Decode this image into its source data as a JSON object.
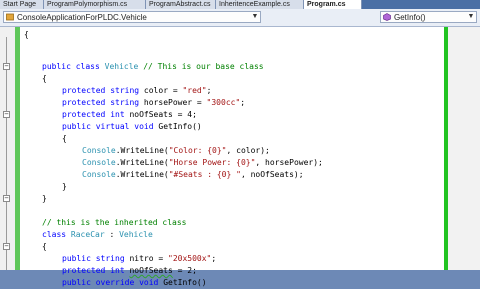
{
  "tabs": [
    {
      "label": "Start Page",
      "active": false
    },
    {
      "label": "ProgramPolymorphism.cs",
      "active": false
    },
    {
      "label": "ProgramAbstract.cs",
      "active": false
    },
    {
      "label": "InheritenceExample.cs",
      "active": false
    },
    {
      "label": "Program.cs",
      "active": true
    }
  ],
  "navbar": {
    "class_combo": "ConsoleApplicationForPLDC.Vehicle",
    "member_combo": "GetInfo()"
  },
  "colors": {
    "keyword": "#0000ff",
    "type": "#2b91af",
    "string": "#a31515",
    "comment": "#008000",
    "change_bar": "#5fc75a",
    "highlight_border": "#22c322"
  },
  "code": {
    "l1": "{",
    "l2_kw1": "public",
    "l2_kw2": "class",
    "l2_type": "Vehicle",
    "l2_comment": "// This is our base class",
    "l3": "{",
    "l4_kw1": "protected",
    "l4_kw2": "string",
    "l4_plain": "color =",
    "l4_str": "\"red\"",
    "l4_end": ";",
    "l5_kw1": "protected",
    "l5_kw2": "string",
    "l5_plain": "horsePower =",
    "l5_str": "\"300cc\"",
    "l5_end": ";",
    "l6_kw1": "protected",
    "l6_kw2": "int",
    "l6_plain": "noOfSeats = 4;",
    "l7_kw1": "public",
    "l7_kw2": "virtual",
    "l7_kw3": "void",
    "l7_plain": "GetInfo()",
    "l8": "{",
    "l9_type": "Console",
    "l9_plain1": ".WriteLine(",
    "l9_str": "\"Color: {0}\"",
    "l9_plain2": ", color);",
    "l10_type": "Console",
    "l10_plain1": ".WriteLine(",
    "l10_str": "\"Horse Power: {0}\"",
    "l10_plain2": ", horsePower);",
    "l11_type": "Console",
    "l11_plain1": ".WriteLine(",
    "l11_str": "\"#Seats : {0} \"",
    "l11_plain2": ", noOfSeats);",
    "l12": "}",
    "l13": "}",
    "l14_comment": "// this is the inherited class",
    "l15_kw": "class",
    "l15_type1": "RaceCar",
    "l15_plain": " : ",
    "l15_type2": "Vehicle",
    "l16": "{",
    "l17_kw1": "public",
    "l17_kw2": "string",
    "l17_plain": "nitro =",
    "l17_str": "\"20x500x\"",
    "l17_end": ";",
    "l18_kw1": "protected",
    "l18_kw2": "int",
    "l18_squig": "noOfSeats",
    "l18_plain": " = 2;",
    "l19_kw1": "public",
    "l19_kw2": "override",
    "l19_kw3": "void",
    "l19_plain": "GetInfo()",
    "l20": "{"
  }
}
